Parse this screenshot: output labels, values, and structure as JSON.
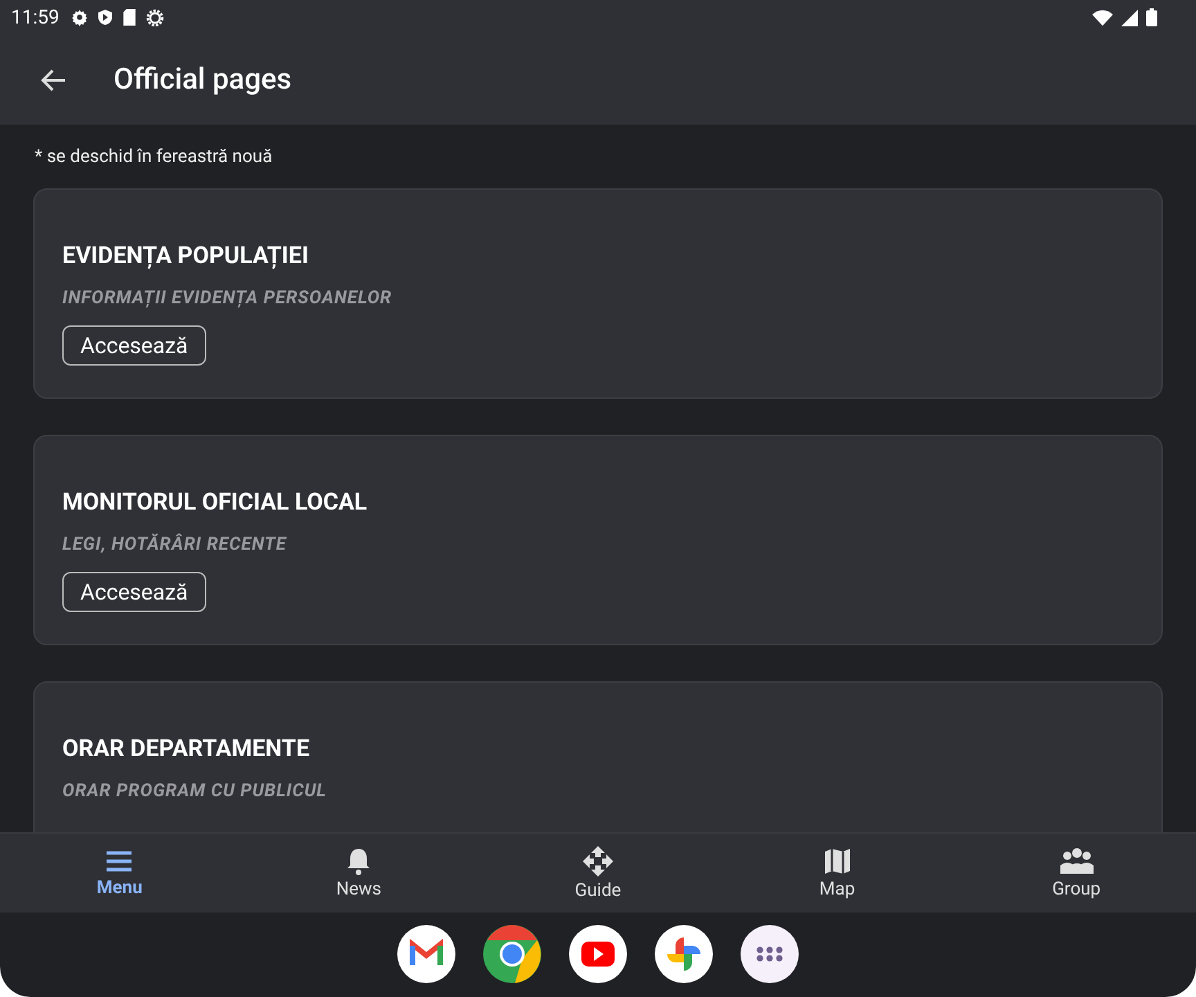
{
  "status_bar": {
    "time": "11:59"
  },
  "app_bar": {
    "title": "Official pages"
  },
  "note": "* se deschid în fereastră nouă",
  "cards": [
    {
      "title": "EVIDENȚA POPULAȚIEI",
      "subtitle": "INFORMAȚII EVIDENȚA PERSOANELOR",
      "button": "Accesează"
    },
    {
      "title": "MONITORUL OFICIAL LOCAL",
      "subtitle": "LEGI, HOTĂRÂRI RECENTE",
      "button": "Accesează"
    },
    {
      "title": "ORAR DEPARTAMENTE",
      "subtitle": "ORAR PROGRAM CU PUBLICUL"
    }
  ],
  "bottom_nav": [
    {
      "label": "Menu",
      "kind": "menu",
      "selected": true
    },
    {
      "label": "News",
      "kind": "bell",
      "selected": false
    },
    {
      "label": "Guide",
      "kind": "arrows",
      "selected": false
    },
    {
      "label": "Map",
      "kind": "map",
      "selected": false
    },
    {
      "label": "Group",
      "kind": "group",
      "selected": false
    }
  ],
  "dock": [
    {
      "kind": "mail"
    },
    {
      "kind": "browser"
    },
    {
      "kind": "video"
    },
    {
      "kind": "photos"
    },
    {
      "kind": "apps"
    }
  ]
}
